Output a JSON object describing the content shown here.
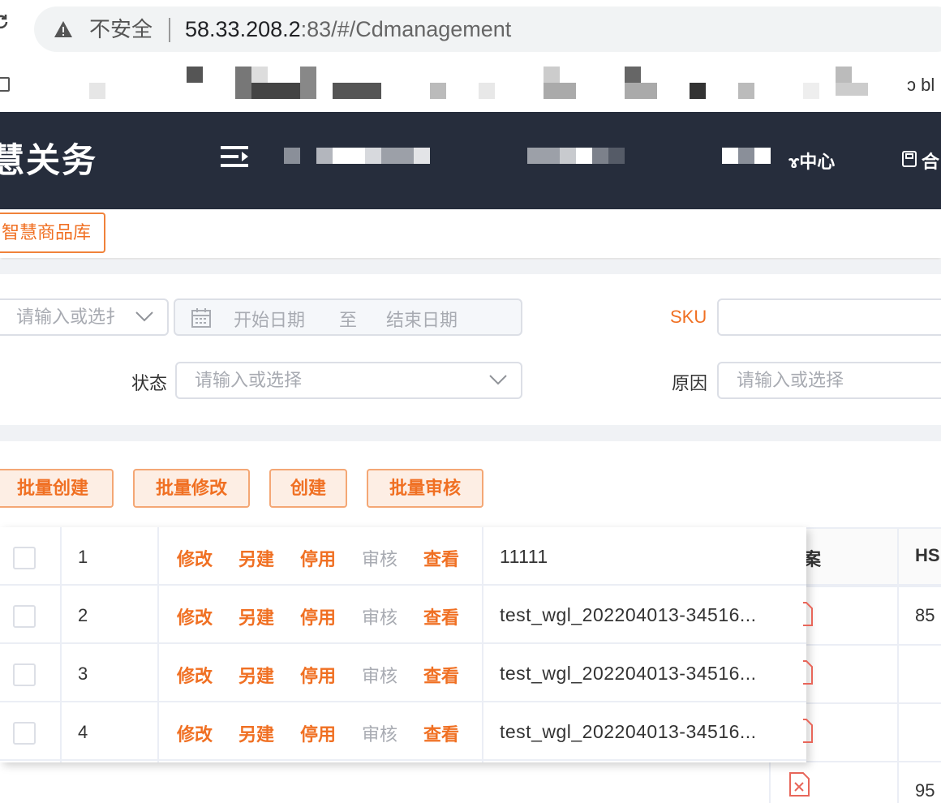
{
  "browser": {
    "insecure_label": "不安全",
    "url_host": "58.33.208.2",
    "url_rest": ":83/#/Cdmanagement",
    "bookmarks_tail": "ɔ bl"
  },
  "header": {
    "app_title": "慧关务",
    "nav_center": "ɤ中心",
    "nav_contract": "合"
  },
  "tags": {
    "active": "智慧商品库"
  },
  "filters": {
    "select1_placeholder": "请输入或选扌",
    "date_start": "开始日期",
    "date_to": "至",
    "date_end": "结束日期",
    "sku_label": "SKU",
    "status_label": "状态",
    "status_placeholder": "请输入或选择",
    "reason_label": "原因",
    "reason_placeholder": "请输入或选择"
  },
  "toolbar": {
    "batch_create": "批量创建",
    "batch_edit": "批量修改",
    "create": "创建",
    "batch_review": "批量审核"
  },
  "table": {
    "partial_headers": {
      "case": "案",
      "hs": "HS"
    },
    "actions": {
      "edit": "修改",
      "copy": "另建",
      "disable": "停用",
      "review": "审核",
      "view": "查看"
    },
    "rows": [
      {
        "index": "1",
        "name": "11111",
        "hs_partial": ""
      },
      {
        "index": "2",
        "name": "test_wgl_202204013-34516...",
        "hs_partial": "85"
      },
      {
        "index": "3",
        "name": "test_wgl_202204013-34516...",
        "hs_partial": ""
      },
      {
        "index": "4",
        "name": "test_wgl_202204013-34516...",
        "hs_partial": ""
      },
      {
        "index": "",
        "name": "",
        "hs_partial": "95"
      }
    ]
  },
  "colors": {
    "accent": "#f07023",
    "nav_bg": "#262d3c"
  }
}
